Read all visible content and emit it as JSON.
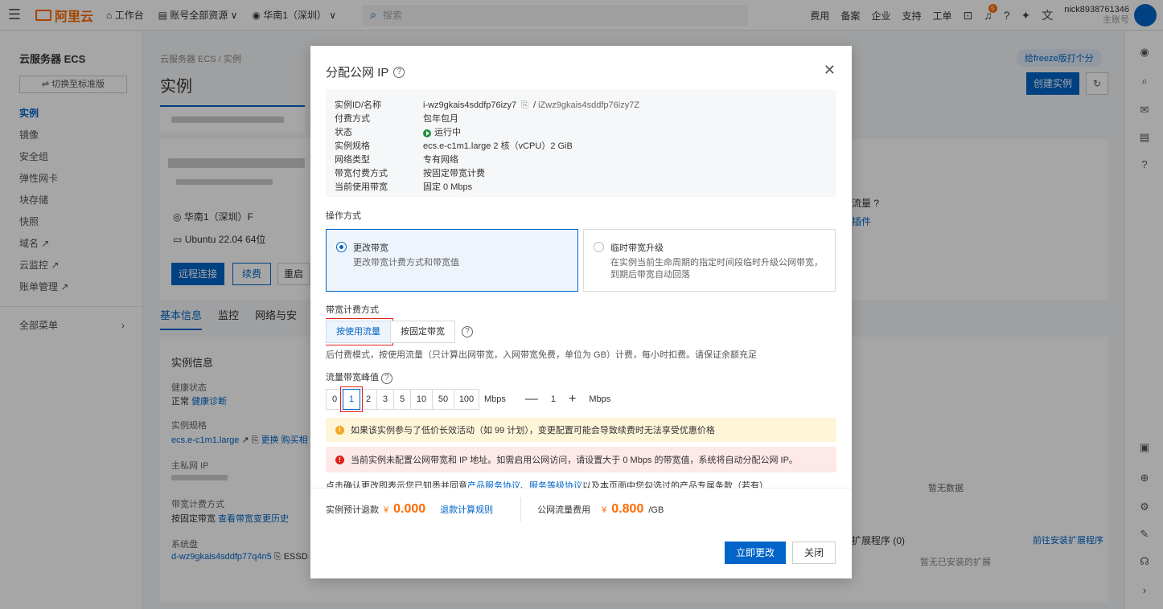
{
  "topbar": {
    "logo_text": "阿里云",
    "workbench": "工作台",
    "resource_scope": "账号全部资源",
    "region": "华南1（深圳）",
    "search_placeholder": "搜索",
    "right_items": [
      "费用",
      "备案",
      "企业",
      "支持",
      "工单"
    ],
    "username": "nick8938761346",
    "subaccount": "主账号",
    "notify_count": "5"
  },
  "sidebar": {
    "title": "云服务器 ECS",
    "switch_label": "切换至标准版",
    "items": [
      "实例",
      "镜像",
      "安全组",
      "弹性网卡",
      "块存储",
      "快照",
      "域名",
      "云监控",
      "账单管理"
    ],
    "all_menu": "全部菜单"
  },
  "page": {
    "breadcrumb": "云服务器 ECS / 实例",
    "title": "实例",
    "region_text": "华南1（深圳）F",
    "os_text": "Ubuntu 22.04 64位",
    "btn_remote": "远程连接",
    "btn_renew": "续费",
    "btn_restart": "重启",
    "tabs": [
      "基本信息",
      "监控",
      "网络与安"
    ],
    "section_instance_info": "实例信息",
    "health_label": "健康状态",
    "health_value": "正常",
    "health_link": "健康诊断",
    "spec_label": "实例规格",
    "spec_value": "ecs.e-c1m1.large",
    "spec_change": "更换",
    "spec_buy": "购买相",
    "private_ip_label": "主私网 IP",
    "bandwidth_label": "带宽计费方式",
    "bandwidth_value": "按固定带宽",
    "bandwidth_link": "查看带宽变更历史",
    "disk_label": "系统盘",
    "disk_value": "d-wz9gkais4sddfp77q4n5",
    "disk_type": "ESSD En",
    "create_btn": "创建实例",
    "feedback_btn": "给freeze版打个分",
    "traffic_label": "流量",
    "plugin_link": "插件",
    "no_data": "暂无数据",
    "ext_title": "扩展程序 (0)",
    "ext_link": "前往安装扩展程序",
    "ext_empty": "暂无已安装的扩展"
  },
  "modal": {
    "title": "分配公网 IP",
    "info": [
      {
        "k": "实例ID/名称",
        "v": "i-wz9gkais4sddfp76izy7",
        "v2": "iZwz9gkais4sddfp76izy7Z"
      },
      {
        "k": "付费方式",
        "v": "包年包月"
      },
      {
        "k": "状态",
        "v": "运行中"
      },
      {
        "k": "实例规格",
        "v": "ecs.e-c1m1.large   2 核（vCPU）2 GiB"
      },
      {
        "k": "网络类型",
        "v": "专有网络"
      },
      {
        "k": "带宽付费方式",
        "v": "按固定带宽计费"
      },
      {
        "k": "当前使用带宽",
        "v": "固定 0 Mbps"
      }
    ],
    "op_label": "操作方式",
    "op_cards": [
      {
        "name": "更改带宽",
        "desc": "更改带宽计费方式和带宽值"
      },
      {
        "name": "临时带宽升级",
        "desc": "在实例当前生命周期的指定时间段临时升级公网带宽，到期后带宽自动回落"
      }
    ],
    "billing_label": "带宽计费方式",
    "billing_options": [
      "按使用流量",
      "按固定带宽"
    ],
    "billing_hint": "后付费模式，按使用流量（只计算出网带宽，入网带宽免费，单位为 GB）计费，每小时扣费。请保证余额充足",
    "peak_label": "流量带宽峰值",
    "peak_values": [
      "0",
      "1",
      "2",
      "3",
      "5",
      "10",
      "50",
      "100"
    ],
    "peak_unit": "Mbps",
    "stepper_value": "1",
    "stepper_unit": "Mbps",
    "warn_text": "如果该实例参与了低价长效活动（如 99 计划），变更配置可能会导致续费时无法享受优惠价格",
    "err_text": "当前实例未配置公网带宽和 IP 地址。如需启用公网访问，请设置大于 0 Mbps 的带宽值，系统将自动分配公网 IP。",
    "agree_prefix": "点击确认更改即表示您已知悉并同意",
    "agree_link1": "产品服务协议",
    "agree_sep": "、",
    "agree_link2": "服务等级协议",
    "agree_suffix": "以及本页面中您勾选过的产品专属条款（若有）",
    "refund_label": "实例预计退款",
    "refund_currency": "¥",
    "refund_amount": "0.000",
    "refund_rule": "退款计算规则",
    "traffic_fee_label": "公网流量费用",
    "traffic_currency": "¥",
    "traffic_amount": "0.800",
    "traffic_unit": "/GB",
    "confirm_btn": "立即更改",
    "close_btn": "关闭"
  }
}
